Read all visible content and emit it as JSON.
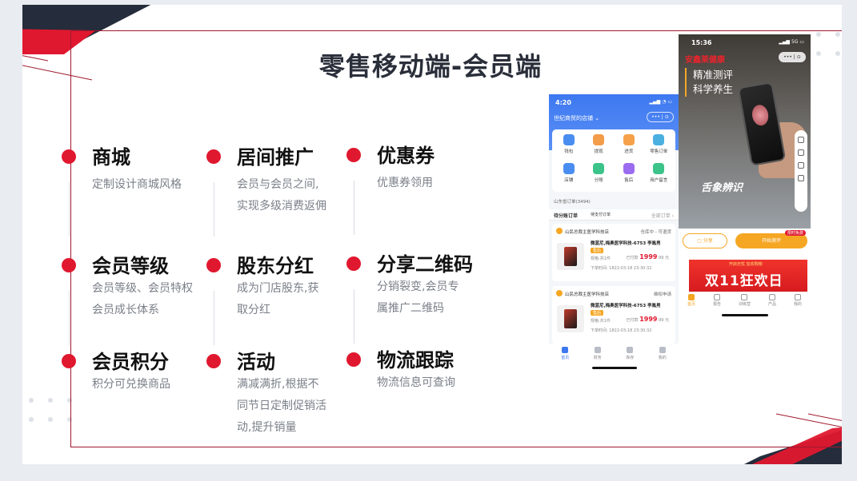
{
  "slide": {
    "title": "零售移动端-会员端",
    "colors": {
      "accent": "#e0182f",
      "dark": "#2a2f3a",
      "frame": "#a0182e"
    }
  },
  "features": [
    {
      "title": "商城",
      "desc": [
        "定制设计商城风格"
      ]
    },
    {
      "title": "居间推广",
      "desc": [
        "会员与会员之间,",
        "实现多级消费返佣"
      ]
    },
    {
      "title": "优惠券",
      "desc": [
        "优惠券领用"
      ]
    },
    {
      "title": "会员等级",
      "desc": [
        "会员等级、会员特权",
        "会员成长体系"
      ]
    },
    {
      "title": "股东分红",
      "desc": [
        "成为门店股东,获",
        "取分红"
      ]
    },
    {
      "title": "分享二维码",
      "desc": [
        "分销裂变,会员专",
        "属推广二维码"
      ]
    },
    {
      "title": "会员积分",
      "desc": [
        "积分可兑换商品"
      ]
    },
    {
      "title": "活动",
      "desc": [
        "满减满折,根据不",
        "同节日定制促销活",
        "动,提升销量"
      ]
    },
    {
      "title": "物流跟踪",
      "desc": [
        "物流信息可查询"
      ]
    }
  ],
  "phone1": {
    "time": "4:20",
    "store": "世纪商贸的店铺 ⌄",
    "capsule": "••• | ⊙",
    "grid": [
      {
        "label": "钱包",
        "icon": "wallet-icon",
        "color": "#4a8df0"
      },
      {
        "label": "提现",
        "icon": "withdraw-icon",
        "color": "#f39c4a"
      },
      {
        "label": "进货",
        "icon": "stock-icon",
        "color": "#f5a14a"
      },
      {
        "label": "零售订单",
        "icon": "order-icon",
        "color": "#4ab0e0"
      },
      {
        "label": "店铺",
        "icon": "store-icon",
        "color": "#4a8df0"
      },
      {
        "label": "分账",
        "icon": "split-icon",
        "color": "#3cc38a"
      },
      {
        "label": "售后",
        "icon": "aftersale-icon",
        "color": "#9b6cf0"
      },
      {
        "label": "用户留言",
        "icon": "message-icon",
        "color": "#3cc38a"
      }
    ],
    "ship_info": "山东省订单(3494)",
    "tabs": [
      "待分账订单",
      "待支付订单",
      "全部订单 ›"
    ],
    "orders": [
      {
        "shop": "山民总裁主医学科技店",
        "status": "仓库中 - 可退货",
        "name": "微蓝尼,梅奥医学科技-6753 李胤男",
        "tag": "售后",
        "spec": "规格:共1件",
        "price_prefix": "已付款",
        "price": "1999",
        "price_cents": ".99 元",
        "time": "下单时间: 1822-03-18 23:30:32"
      },
      {
        "shop": "山民总裁主医学科技店",
        "status": "维权申请",
        "name": "微蓝尼,梅奥医学科技-6753 李胤男",
        "tag": "售后",
        "spec": "规格:共1件",
        "price_prefix": "已付款",
        "price": "1999",
        "price_cents": ".99 元",
        "time": "下单时间: 1822-03-18 23:30:32"
      }
    ],
    "nav": [
      "首页",
      "财务",
      "库存",
      "我的"
    ]
  },
  "phone2": {
    "time": "15:36",
    "signal": "5G",
    "brand": "安鑫莱健康",
    "capsule": "••• | ⊙",
    "slogan": [
      "精准测评",
      "科学养生"
    ],
    "tongue": "舌象辨识",
    "share": "分享",
    "start": "开始测评",
    "free_tag": "限时免费",
    "banner_sub": "开启无忧 狂欢购物",
    "banner": "双11狂欢日",
    "nav": [
      "首页",
      "报告",
      "训练营",
      "产品",
      "我的"
    ]
  }
}
